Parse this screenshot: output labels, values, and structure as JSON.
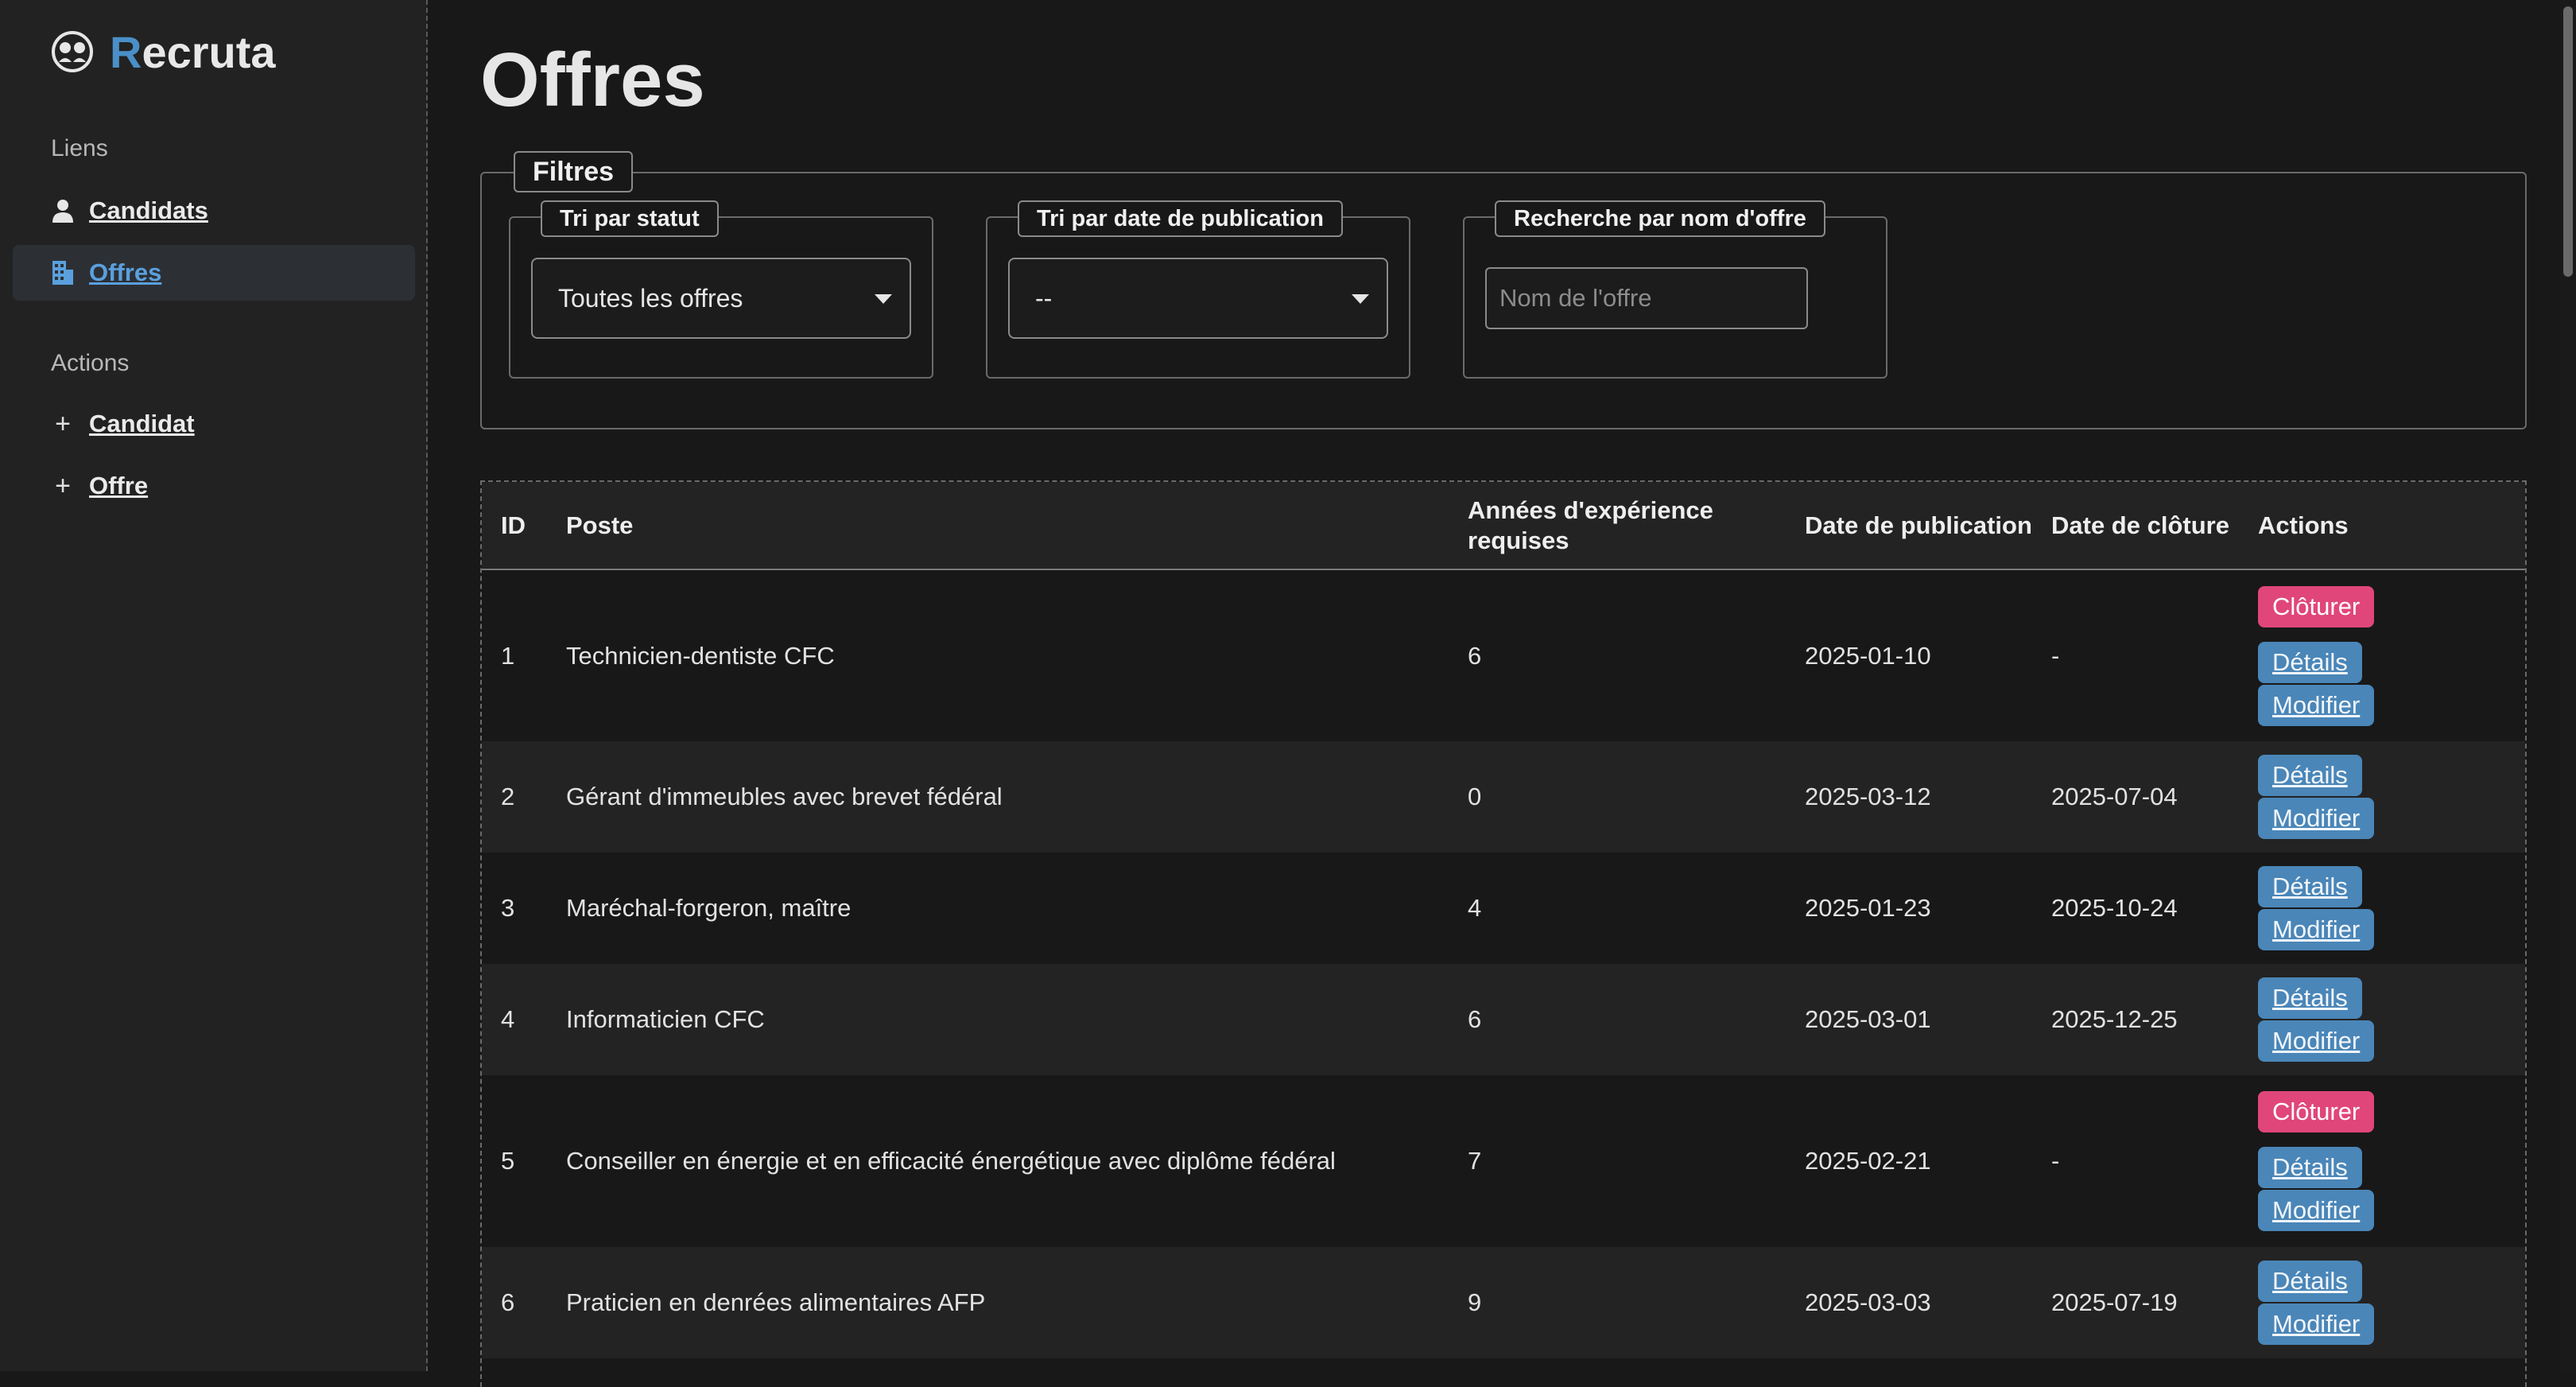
{
  "app": {
    "brand_initial": "R",
    "brand_rest": "ecruta"
  },
  "sidebar": {
    "links_title": "Liens",
    "links": [
      {
        "label": "Candidats",
        "icon": "person-icon"
      },
      {
        "label": "Offres",
        "icon": "building-icon",
        "active": true
      }
    ],
    "actions_title": "Actions",
    "actions": [
      {
        "label": "Candidat",
        "icon": "plus-icon"
      },
      {
        "label": "Offre",
        "icon": "plus-icon"
      }
    ]
  },
  "page": {
    "title": "Offres"
  },
  "filters": {
    "legend": "Filtres",
    "status": {
      "legend": "Tri par statut",
      "value": "Toutes les offres"
    },
    "date": {
      "legend": "Tri par date de publication",
      "value": "--"
    },
    "search": {
      "legend": "Recherche par nom d'offre",
      "placeholder": "Nom de l'offre"
    }
  },
  "table": {
    "columns": [
      "ID",
      "Poste",
      "Années d'expérience requises",
      "Date de publication",
      "Date de clôture",
      "Actions"
    ],
    "actions": {
      "close": "Clôturer",
      "details": "Détails",
      "edit": "Modifier"
    },
    "rows": [
      {
        "id": "1",
        "poste": "Technicien-dentiste CFC",
        "experience": "6",
        "publication": "2025-01-10",
        "cloture": "-",
        "closable": true
      },
      {
        "id": "2",
        "poste": "Gérant d'immeubles avec brevet fédéral",
        "experience": "0",
        "publication": "2025-03-12",
        "cloture": "2025-07-04",
        "closable": false
      },
      {
        "id": "3",
        "poste": "Maréchal-forgeron, maître",
        "experience": "4",
        "publication": "2025-01-23",
        "cloture": "2025-10-24",
        "closable": false
      },
      {
        "id": "4",
        "poste": "Informaticien CFC",
        "experience": "6",
        "publication": "2025-03-01",
        "cloture": "2025-12-25",
        "closable": false
      },
      {
        "id": "5",
        "poste": "Conseiller en énergie et en efficacité énergétique avec diplôme fédéral",
        "experience": "7",
        "publication": "2025-02-21",
        "cloture": "-",
        "closable": true
      },
      {
        "id": "6",
        "poste": "Praticien en denrées alimentaires AFP",
        "experience": "9",
        "publication": "2025-03-03",
        "cloture": "2025-07-19",
        "closable": false
      }
    ]
  },
  "colors": {
    "accent": "#4a8fc7",
    "danger": "#e0467a",
    "info": "#4a86b8",
    "background": "#181818",
    "sidebar": "#222222"
  }
}
